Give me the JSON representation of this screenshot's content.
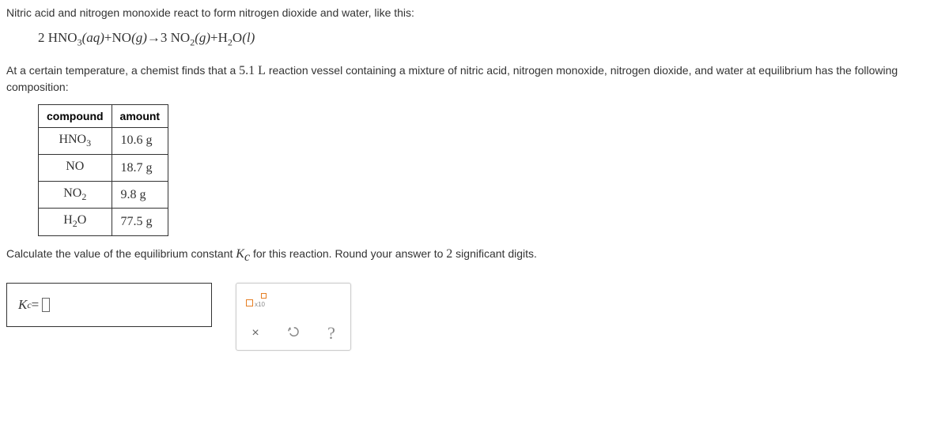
{
  "intro": "Nitric acid and nitrogen monoxide react to form nitrogen dioxide and water, like this:",
  "equation": {
    "c1": "2",
    "r1": "HNO",
    "r1sub": "3",
    "r1state": "(aq)",
    "plus1": "+",
    "r2": "NO",
    "r2state": "(g)",
    "arrow": "→",
    "c2": "3",
    "p1": "NO",
    "p1sub": "2",
    "p1state": "(g)",
    "plus2": "+",
    "p2": "H",
    "p2sub": "2",
    "p2b": "O",
    "p2state": "(l)"
  },
  "context_a": "At a certain temperature, a chemist finds that a ",
  "vessel": "5.1 L",
  "context_b": " reaction vessel containing a mixture of nitric acid, nitrogen monoxide, nitrogen dioxide, and water at equilibrium has the following composition:",
  "table": {
    "h1": "compound",
    "h2": "amount",
    "rows": [
      {
        "name_a": "HNO",
        "name_sub": "3",
        "name_b": "",
        "amount": "10.6 g"
      },
      {
        "name_a": "NO",
        "name_sub": "",
        "name_b": "",
        "amount": "18.7 g"
      },
      {
        "name_a": "NO",
        "name_sub": "2",
        "name_b": "",
        "amount": "9.8 g"
      },
      {
        "name_a": "H",
        "name_sub": "2",
        "name_b": "O",
        "amount": "77.5 g"
      }
    ]
  },
  "instruct_a": "Calculate the value of the equilibrium constant ",
  "kc": {
    "K": "K",
    "c": "c"
  },
  "instruct_b": " for this reaction. Round your answer to ",
  "sigfigs": "2",
  "instruct_c": " significant digits.",
  "answer": {
    "K": "K",
    "c": "c",
    "eq": " = "
  },
  "tools": {
    "clear": "×",
    "help": "?"
  }
}
